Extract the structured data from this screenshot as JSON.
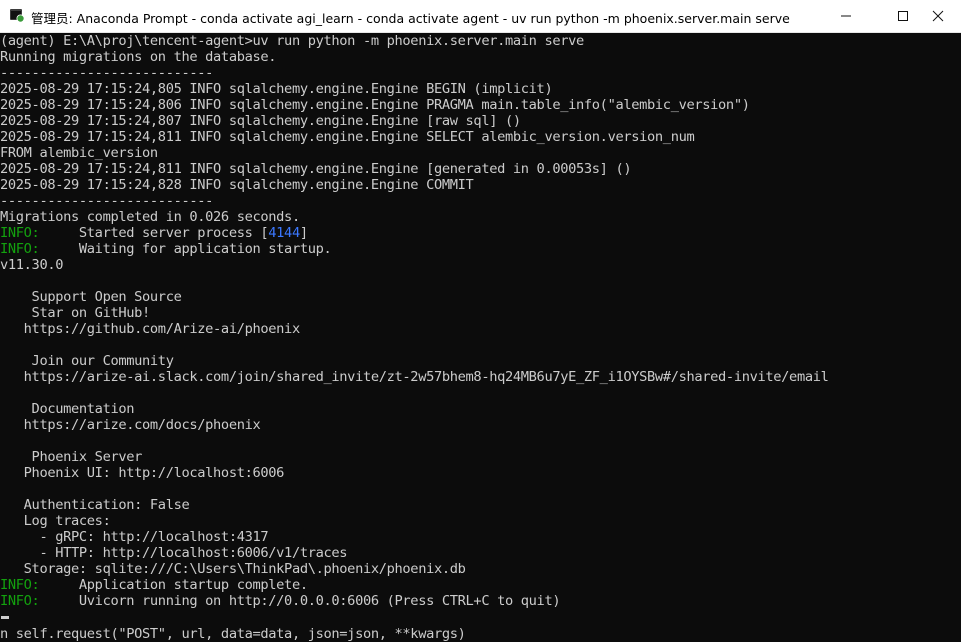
{
  "window": {
    "title": "管理员: Anaconda Prompt - conda  activate agi_learn - conda  activate agent - uv  run python -m phoenix.server.main serve",
    "icon": "terminal-icon",
    "controls": {
      "minimize": "minimize-icon",
      "maximize": "maximize-icon",
      "close": "close-icon"
    }
  },
  "colors": {
    "background": "#0c0c0c",
    "text": "#cccccc",
    "info": "#13a10e",
    "pid": "#3b78ff"
  },
  "console": {
    "lines": [
      "(agent) E:\\A\\proj\\tencent-agent>uv run python -m phoenix.server.main serve",
      "Running migrations on the database.",
      "---------------------------",
      "2025-08-29 17:15:24,805 INFO sqlalchemy.engine.Engine BEGIN (implicit)",
      "2025-08-29 17:15:24,806 INFO sqlalchemy.engine.Engine PRAGMA main.table_info(\"alembic_version\")",
      "2025-08-29 17:15:24,807 INFO sqlalchemy.engine.Engine [raw sql] ()",
      "2025-08-29 17:15:24,811 INFO sqlalchemy.engine.Engine SELECT alembic_version.version_num",
      "FROM alembic_version",
      "2025-08-29 17:15:24,811 INFO sqlalchemy.engine.Engine [generated in 0.00053s] ()",
      "2025-08-29 17:15:24,828 INFO sqlalchemy.engine.Engine COMMIT",
      "---------------------------",
      "Migrations completed in 0.026 seconds.",
      "",
      "",
      "v11.30.0",
      "",
      "    Support Open Source",
      "    Star on GitHub!",
      "   https://github.com/Arize-ai/phoenix",
      "",
      "    Join our Community",
      "   https://arize-ai.slack.com/join/shared_invite/zt-2w57bhem8-hq24MB6u7yE_ZF_i1OYSBw#/shared-invite/email",
      "",
      "    Documentation",
      "   https://arize.com/docs/phoenix",
      "",
      "    Phoenix Server",
      "   Phoenix UI: http://localhost:6006",
      "",
      "   Authentication: False",
      "   Log traces:",
      "     - gRPC: http://localhost:4317",
      "     - HTTP: http://localhost:6006/v1/traces",
      "   Storage: sqlite:///C:\\Users\\ThinkPad\\.phoenix/phoenix.db"
    ],
    "info_prefix": "INFO:",
    "info_started": "     Started server process [",
    "info_pid": "4144",
    "info_started_end": "]",
    "info_waiting": "     Waiting for application startup.",
    "info_complete": "     Application startup complete.",
    "info_uvicorn": "     Uvicorn running on http://0.0.0.0:6006 (Press CTRL+C to quit)",
    "clipped_line": "n self.request(\"POST\", url, data=data, json=json, **kwargs)"
  }
}
